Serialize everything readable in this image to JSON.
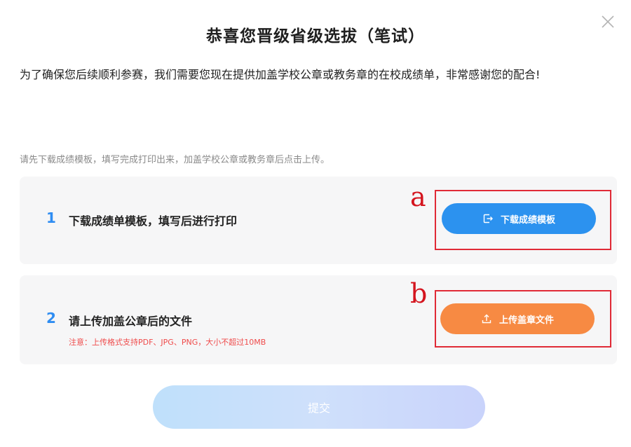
{
  "dialog": {
    "title": "恭喜您晋级省级选拔（笔试）",
    "intro": "为了确保您后续顺利参赛，我们需要您现在提供加盖学校公章或教务章的在校成绩单，非常感谢您的配合!",
    "hint": "请先下载成绩模板，填写完成打印出来，加盖学校公章或教务章后点击上传。",
    "close_icon": "close-icon"
  },
  "steps": [
    {
      "number": "1",
      "title": "下载成绩单模板，填写后进行打印",
      "button_label": "下载成绩模板",
      "button_icon": "download-export-icon",
      "button_color": "#2c92ef"
    },
    {
      "number": "2",
      "title": "请上传加盖公章后的文件",
      "note": "注意：上传格式支持PDF、JPG、PNG，大小不超过10MB",
      "button_label": "上传盖章文件",
      "button_icon": "upload-icon",
      "button_color": "#f78a43"
    }
  ],
  "annotations": {
    "a": "a",
    "b": "b",
    "color": "#d4141e"
  },
  "submit": {
    "label": "提交"
  }
}
